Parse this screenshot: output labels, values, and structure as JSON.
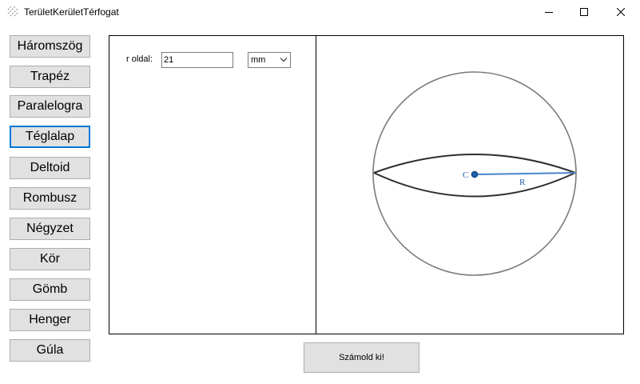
{
  "window": {
    "title": "TerületKerületTérfogat",
    "icon": "app-icon",
    "controls": [
      "minimize-icon",
      "maximize-icon",
      "close-icon"
    ]
  },
  "sidebar": {
    "buttons": [
      {
        "label": "Háromszög"
      },
      {
        "label": "Trapéz"
      },
      {
        "label": "Paralelogra"
      },
      {
        "label": "Téglalap",
        "selected": true
      },
      {
        "label": "Deltoid"
      },
      {
        "label": "Rombusz"
      },
      {
        "label": "Négyzet"
      },
      {
        "label": "Kör"
      },
      {
        "label": "Gömb"
      },
      {
        "label": "Henger"
      },
      {
        "label": "Gúla"
      }
    ]
  },
  "input_panel": {
    "r_label": "r oldal:",
    "r_value": "21",
    "unit": "mm"
  },
  "figure": {
    "center_label": "C",
    "radius_label": "R",
    "radius_color": "#4a86c8",
    "outline_color": "#777777"
  },
  "calculate_button": "Számold ki!",
  "colors": {
    "selected_border": "#0078d7",
    "button_face": "#e1e1e1"
  }
}
